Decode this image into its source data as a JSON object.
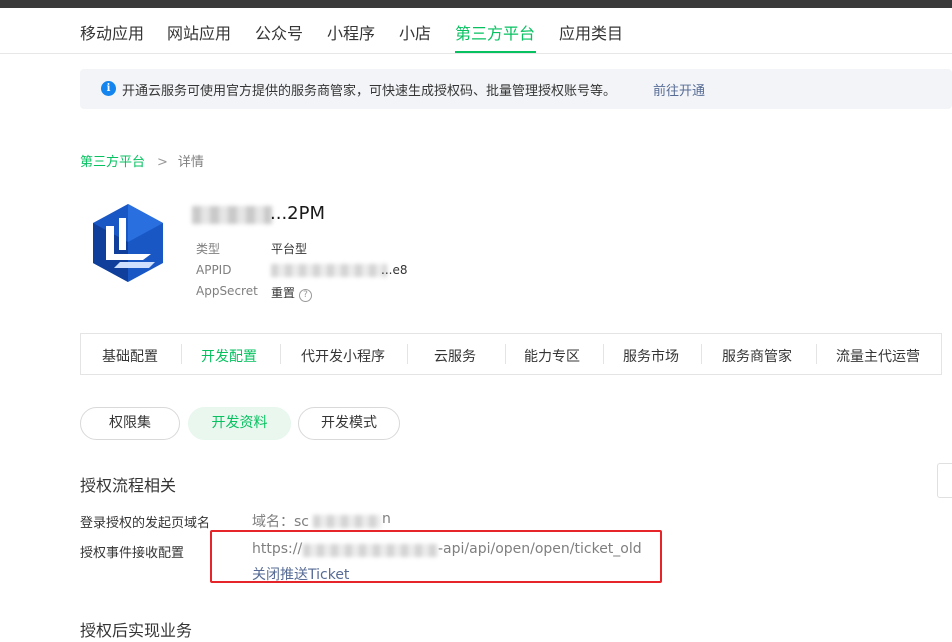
{
  "nav": {
    "items": [
      "移动应用",
      "网站应用",
      "公众号",
      "小程序",
      "小店",
      "第三方平台",
      "应用类目"
    ],
    "active": "第三方平台"
  },
  "notice": {
    "icon": "info-icon",
    "text": "开通云服务可使用官方提供的服务商管家，可快速生成授权码、批量管理授权账号等。",
    "link": "前往开通"
  },
  "breadcrumb": {
    "parent": "第三方平台",
    "separator": ">",
    "current": "详情"
  },
  "app": {
    "name_visible": "...2PM",
    "type_label": "类型",
    "type_value": "平台型",
    "appid_label": "APPID",
    "appid_visible": "...e8",
    "secret_label": "AppSecret",
    "secret_action": "重置",
    "help_icon": "question-circle-icon"
  },
  "tabs": {
    "items": [
      "基础配置",
      "开发配置",
      "代开发小程序",
      "云服务",
      "能力专区",
      "服务市场",
      "服务商管家",
      "流量主代运营"
    ],
    "active": "开发配置"
  },
  "subtabs": {
    "items": [
      "权限集",
      "开发资料",
      "开发模式"
    ],
    "active": "开发资料"
  },
  "auth_flow": {
    "title": "授权流程相关",
    "login_domain_label": "登录授权的发起页域名",
    "login_domain_prefix": "域名：",
    "login_domain_visible_start": "sc",
    "login_domain_visible_end": "n",
    "event_label": "授权事件接收配置",
    "event_url_prefix": "https://",
    "event_url_suffix": "-api/api/open/open/ticket_old",
    "event_close_link": "关闭推送Ticket"
  },
  "after_auth": {
    "title": "授权后实现业务"
  },
  "colors": {
    "accent": "#07c160",
    "link": "#576b95",
    "highlight_box": "#e5252a",
    "info_icon": "#1485ee"
  }
}
